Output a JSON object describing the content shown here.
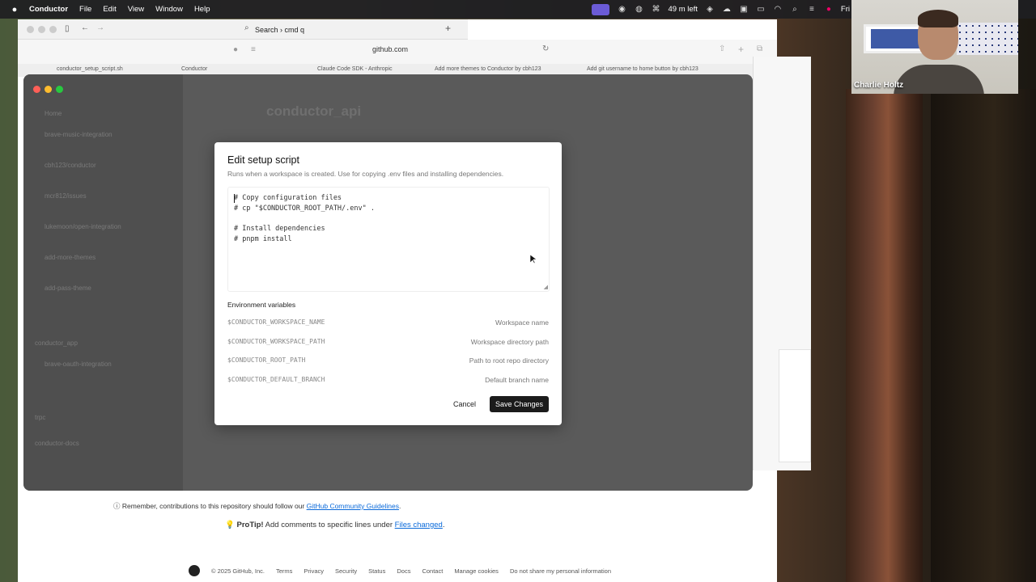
{
  "menubar": {
    "app_name": "Conductor",
    "items": [
      "File",
      "Edit",
      "View",
      "Window",
      "Help"
    ],
    "battery_text": "49 m left",
    "clock_text": "Fri"
  },
  "video_call": {
    "participant_name": "Charlie Holtz"
  },
  "browser": {
    "search_title": "Search › cmd q",
    "url": "github.com",
    "tabs": [
      "conductor_setup_script.sh",
      "Conductor",
      "Claude Code SDK - Anthropic",
      "Add more themes to Conductor by cbh123",
      "Add git username to home button by cbh123"
    ]
  },
  "github": {
    "remember_prefix": "Remember, contributions to this repository should follow our ",
    "remember_link": "GitHub Community Guidelines",
    "remember_suffix": ".",
    "protip_bold": "ProTip!",
    "protip_text": " Add comments to specific lines under ",
    "protip_link": "Files changed",
    "protip_suffix": ".",
    "footer": {
      "copyright": "© 2025 GitHub, Inc.",
      "links": [
        "Terms",
        "Privacy",
        "Security",
        "Status",
        "Docs",
        "Contact",
        "Manage cookies",
        "Do not share my personal information"
      ]
    }
  },
  "conductor": {
    "main_title": "conductor_api",
    "sidebar": {
      "home": "Home",
      "items": [
        "brave-music-integration",
        "cbh123/conductor",
        "mcr812/issues",
        "lukemoon/open-integration",
        "add-more-themes",
        "add-pass-theme"
      ],
      "repo2": "conductor_app",
      "repo2_items": [
        "brave-oauth-integration"
      ],
      "repo3": "trpc",
      "repo4": "conductor-docs"
    }
  },
  "modal": {
    "title": "Edit setup script",
    "description": "Runs when a workspace is created. Use for copying .env files and installing dependencies.",
    "script_lines": [
      "# Copy configuration files",
      "# cp \"$CONDUCTOR_ROOT_PATH/.env\" .",
      "",
      "# Install dependencies",
      "# pnpm install"
    ],
    "env_heading": "Environment variables",
    "env_vars": [
      {
        "name": "$CONDUCTOR_WORKSPACE_NAME",
        "description": "Workspace name"
      },
      {
        "name": "$CONDUCTOR_WORKSPACE_PATH",
        "description": "Workspace directory path"
      },
      {
        "name": "$CONDUCTOR_ROOT_PATH",
        "description": "Path to root repo directory"
      },
      {
        "name": "$CONDUCTOR_DEFAULT_BRANCH",
        "description": "Default branch name"
      }
    ],
    "cancel_label": "Cancel",
    "save_label": "Save Changes"
  }
}
